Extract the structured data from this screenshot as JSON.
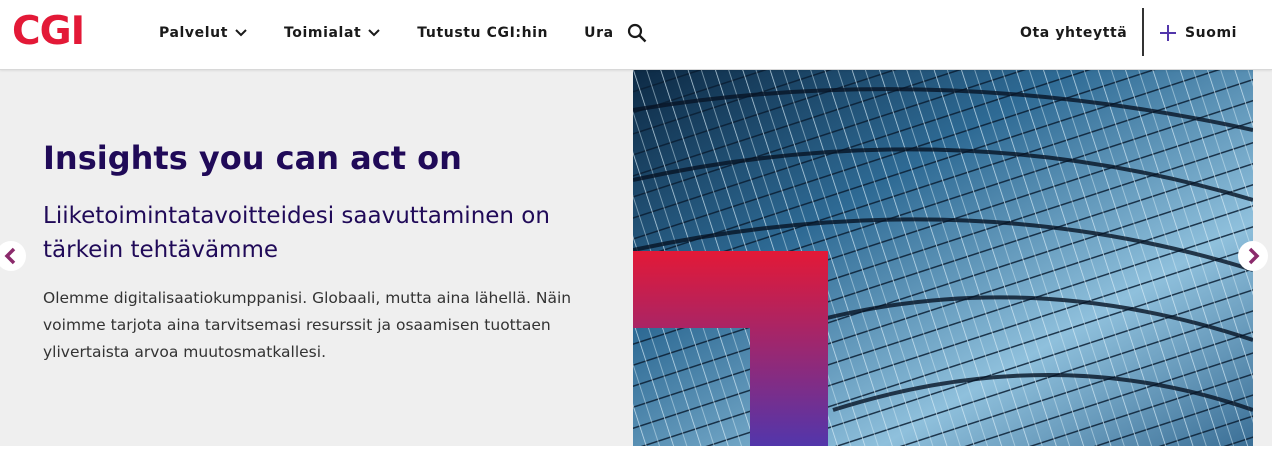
{
  "brand": {
    "logo_text": "CGI",
    "color": "#e31937"
  },
  "nav": {
    "items": [
      {
        "label": "Palvelut",
        "has_dropdown": true
      },
      {
        "label": "Toimialat",
        "has_dropdown": true
      },
      {
        "label": "Tutustu CGI:hin",
        "has_dropdown": false
      },
      {
        "label": "Ura",
        "has_dropdown": false
      }
    ],
    "search_icon": "search-icon",
    "contact_label": "Ota yhteyttä",
    "language_label": "Suomi",
    "language_icon": "plus-icon"
  },
  "hero": {
    "title": "Insights you can act on",
    "subtitle": "Liiketoimintatavoitteidesi saavuttaminen on tärkein tehtävämme",
    "body": "Olemme digitalisaatiokumppanisi. Globaali, mutta aina lähellä. Näin voimme tarjota aina tarvitsemasi resurssit ja osaamisen tuottaen ylivertaista arvoa muutosmatkallesi.",
    "prev_icon": "chevron-left-icon",
    "next_icon": "chevron-right-icon"
  },
  "colors": {
    "title": "#200a58",
    "accent_red": "#e31937",
    "accent_purple": "#5236ab",
    "hero_bg": "#efefef"
  }
}
